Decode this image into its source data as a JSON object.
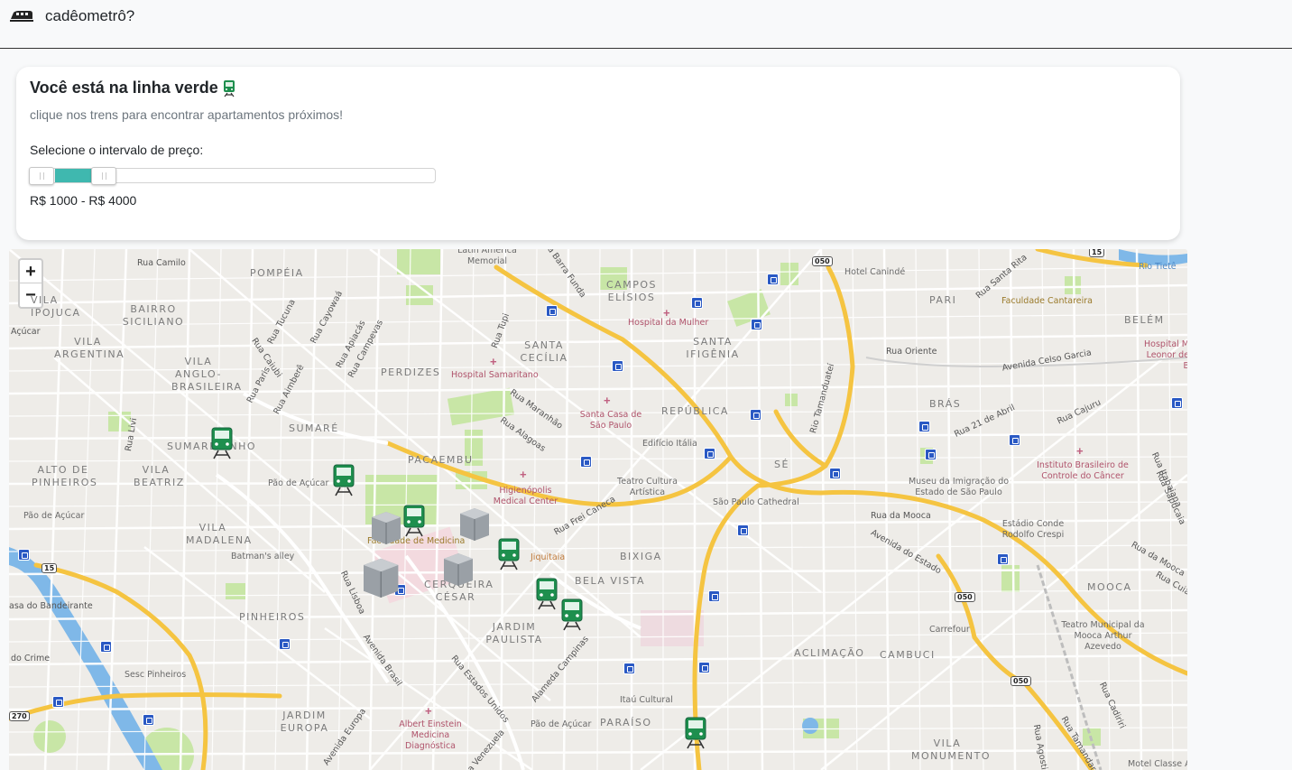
{
  "app": {
    "name": "cadêometrô?",
    "icon": "train-silhouette-icon"
  },
  "panel": {
    "title": "Você está na linha verde",
    "title_icon": "green-train-icon",
    "subtitle": "clique nos trens para encontrar apartamentos próximos!",
    "price_label": "Selecione o intervalo de preço:",
    "price_range_text": "R$ 1000 - R$ 4000",
    "price_min": 1000,
    "price_max": 4000
  },
  "map": {
    "zoom_in": "+",
    "zoom_out": "−",
    "colors": {
      "line": "#1e8f4e",
      "metro_pin": "#2a59c4",
      "highway": "#f5c441",
      "park": "#c8e6a6",
      "water": "#7fb8e8"
    },
    "districts": [
      "POMPÉIA",
      "VILA IPOJUCA",
      "BAIRRO SICILIANO",
      "VILA ARGENTINA",
      "VILA ANGLO-BRASILEIRA",
      "PERDIZES",
      "SANTA CECÍLIA",
      "CAMPOS ELÍSIOS",
      "SANTA IFIGÊNIA",
      "PARI",
      "BELÉM",
      "SUMARÉ",
      "SUMAREZINHO",
      "ALTO DE PINHEIROS",
      "VILA BEATRIZ",
      "PACAEMBU",
      "REPÚBLICA",
      "BRÁS",
      "SÉ",
      "VILA MADALENA",
      "BIXIGA",
      "BELA VISTA",
      "CERQUEIRA CÉSAR",
      "JARDIM PAULISTA",
      "PINHEIROS",
      "JARDIM EUROPA",
      "PARAÍSO",
      "ACLIMAÇÃO",
      "CAMBUCI",
      "MOOCA",
      "VILA MONUMENTO"
    ],
    "streets": [
      "Rua Camilo",
      "Rua Tucuna",
      "Rua Cayowaá",
      "Rua Apiacás",
      "Rua Caiubi",
      "Rua Campevas",
      "Rua Paris",
      "Rua Aimberê",
      "Rua Tupi",
      "Rua Barra Funda",
      "Rua Maranhão",
      "Rua Alagoas",
      "Rua Frei Caneca",
      "Rua Lisboa",
      "Avenida Brasil",
      "Rua Estados Unidos",
      "Alameda Campinas",
      "Avenida Europa",
      "Rua Venezuela",
      "Rua Oriente",
      "Avenida Celso Garcia",
      "Rua Santa Rita",
      "Rua 21 de Abril",
      "Rua Cajuru",
      "Rua da Mooca",
      "Avenida do Estado",
      "Rua Itabaiana",
      "Rua Sapucaia",
      "Rua da Mooca",
      "Rua Cuiabá",
      "Rua Cadiriri",
      "Rua Agostinho",
      "Rua Tamandaré",
      "Rua Livi",
      "Rio Tamanduateí",
      "Rio Tietê",
      "Açúcar",
      "do Crime",
      "asa do Bandeirante"
    ],
    "places": [
      "Latin America Memorial",
      "Hospital da Mulher",
      "Hotel Canindé",
      "Faculdade Cantareira",
      "Hospital Samaritano",
      "Santa Casa de São Paulo",
      "Edifício Itália",
      "Hospital M Leonor de B",
      "Instituto Brasileiro de Controle do Câncer",
      "Museu da Imigração do Estado de São Paulo",
      "Estádio Conde Rodolfo Crespi",
      "Teatro Cultura Artística",
      "São Paulo Cathedral",
      "Higienópolis Medical Center",
      "Pão de Açúcar",
      "Faculdade de Medicina",
      "Jiquitaia",
      "Batman's alley",
      "Teatro Municipal da Mooca Arthur Azevedo",
      "Carrefour",
      "Sesc Pinheiros",
      "Itaú Cultural",
      "Albert Einstein Medicina Diagnóstica",
      "Motel Classe A"
    ],
    "highway_shields": [
      "050",
      "15",
      "270",
      "050",
      "050",
      "15"
    ],
    "trains": [
      {
        "name": "train-station-sumarezinho"
      },
      {
        "name": "train-station-sumare"
      },
      {
        "name": "train-station-clinicas"
      },
      {
        "name": "train-station-consolacao"
      },
      {
        "name": "train-station-trianon"
      },
      {
        "name": "train-station-brigadeiro"
      },
      {
        "name": "train-station-paraiso"
      }
    ]
  }
}
